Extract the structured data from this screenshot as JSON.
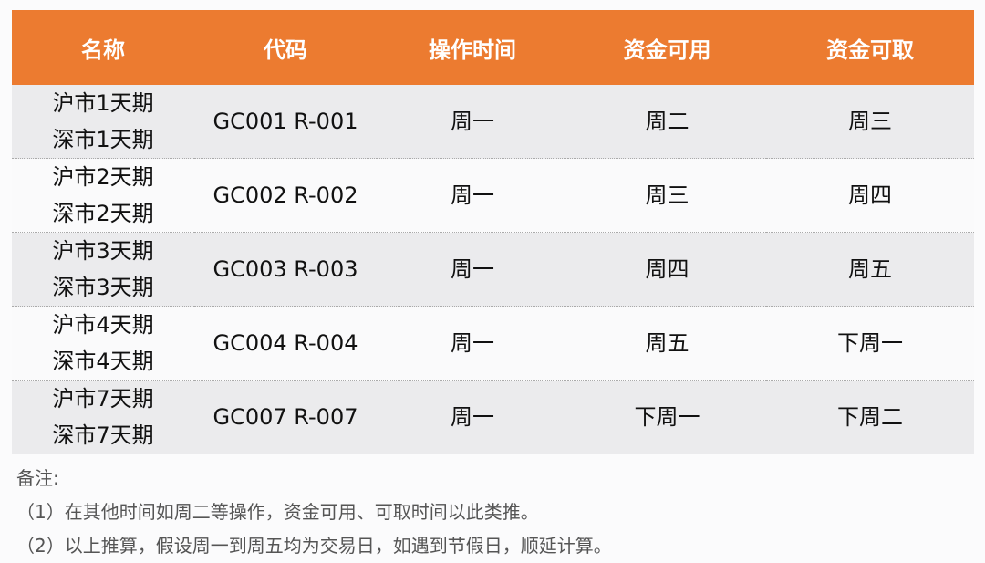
{
  "colors": {
    "header": "#ec7b30",
    "row_alt": "#ebebed"
  },
  "headers": [
    "名称",
    "代码",
    "操作时间",
    "资金可用",
    "资金可取"
  ],
  "rows": [
    {
      "name1": "沪市1天期",
      "name2": "深市1天期",
      "code": "GC001 R-001",
      "op": "周一",
      "avail": "周二",
      "withdraw": "周三"
    },
    {
      "name1": "沪市2天期",
      "name2": "深市2天期",
      "code": "GC002 R-002",
      "op": "周一",
      "avail": "周三",
      "withdraw": "周四"
    },
    {
      "name1": "沪市3天期",
      "name2": "深市3天期",
      "code": "GC003 R-003",
      "op": "周一",
      "avail": "周四",
      "withdraw": "周五"
    },
    {
      "name1": "沪市4天期",
      "name2": "深市4天期",
      "code": "GC004 R-004",
      "op": "周一",
      "avail": "周五",
      "withdraw": "下周一"
    },
    {
      "name1": "沪市7天期",
      "name2": "深市7天期",
      "code": "GC007 R-007",
      "op": "周一",
      "avail": "下周一",
      "withdraw": "下周二"
    }
  ],
  "notes": {
    "title": "备注:",
    "items": [
      "（1）在其他时间如周二等操作，资金可用、可取时间以此类推。",
      "（2）以上推算，假设周一到周五均为交易日，如遇到节假日，顺延计算。"
    ]
  }
}
